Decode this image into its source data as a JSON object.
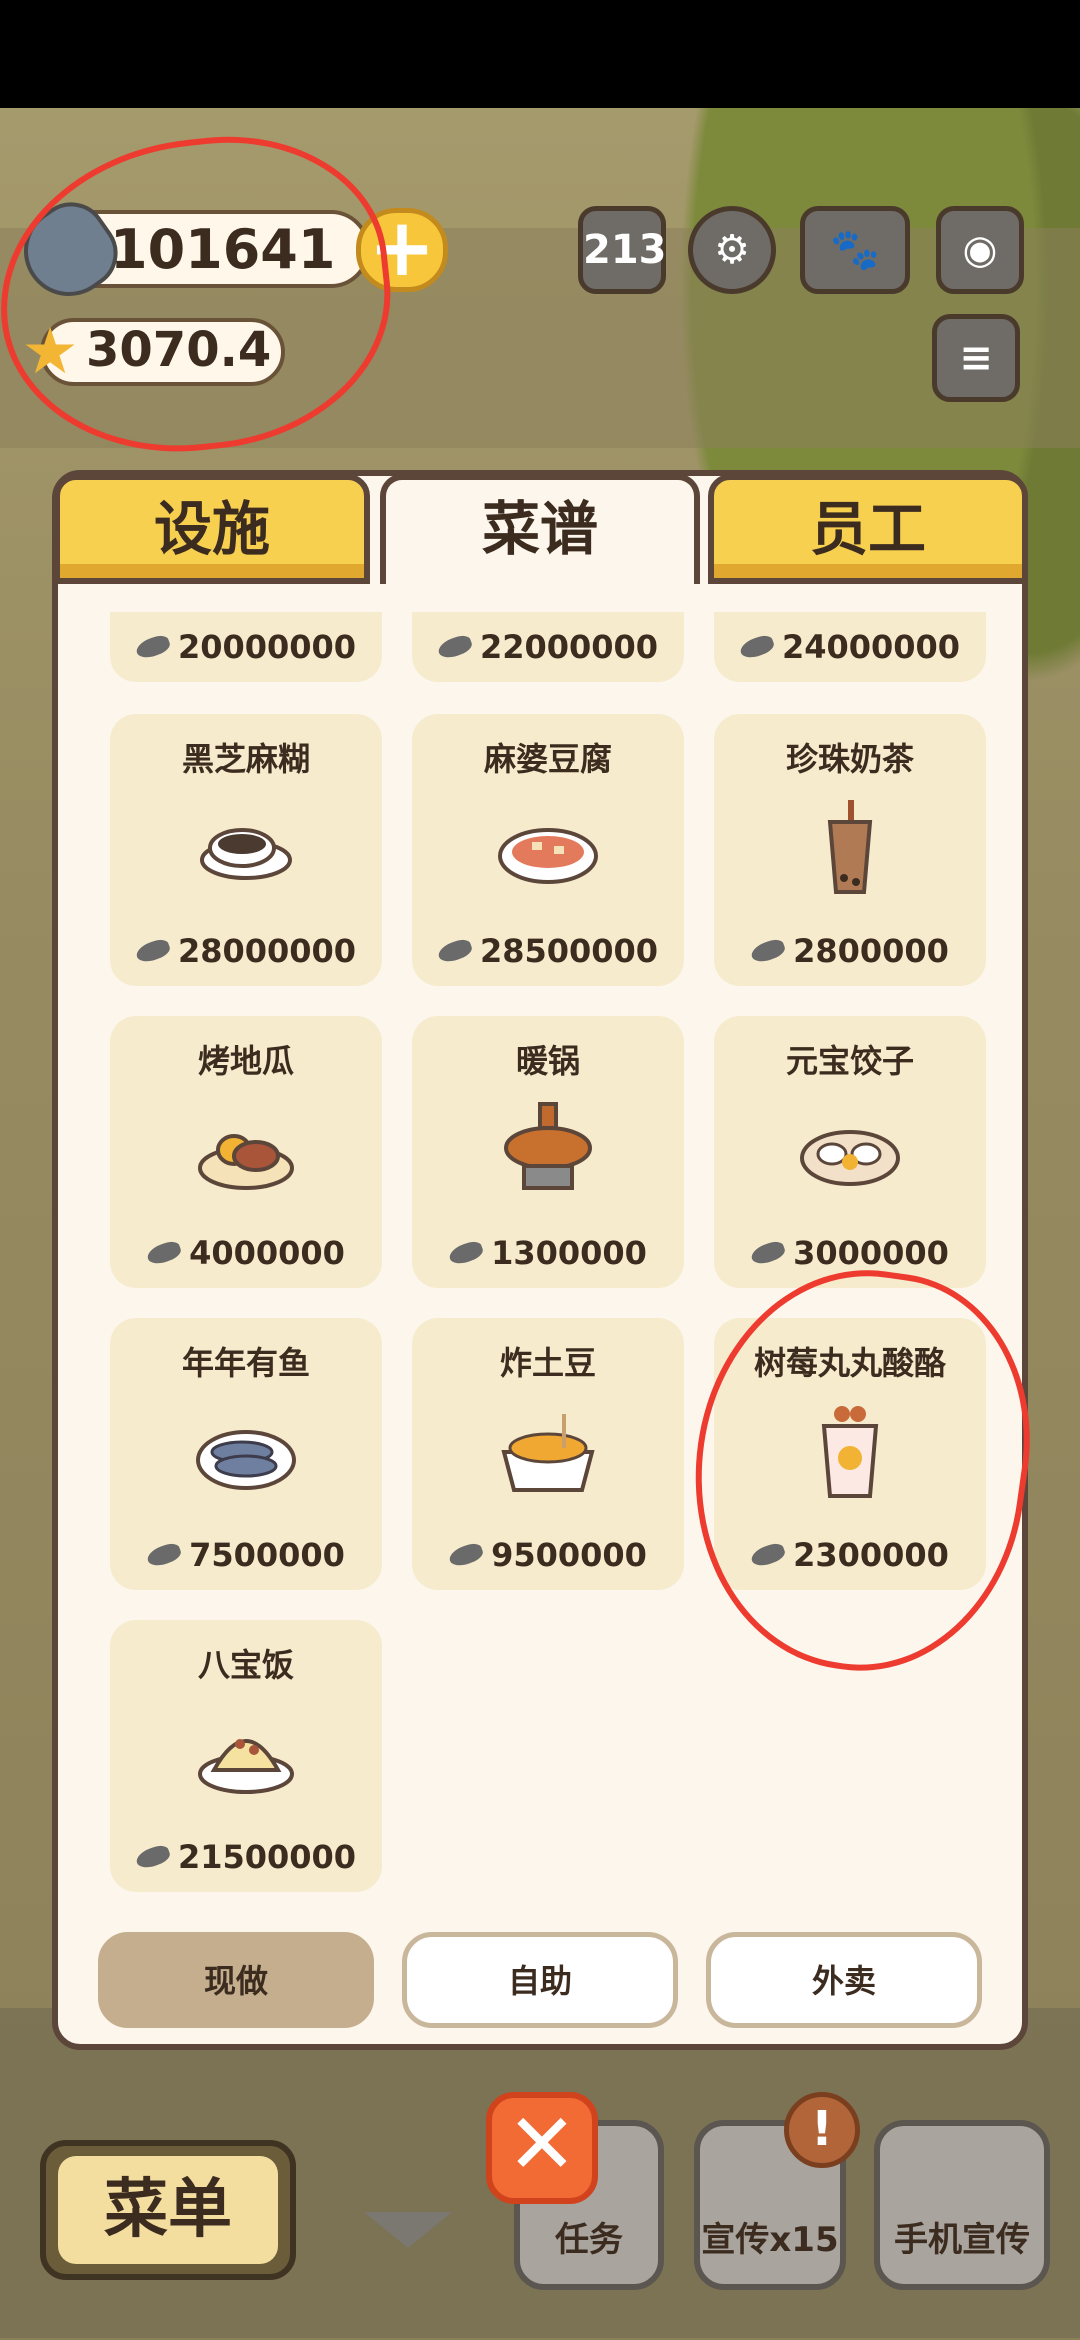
{
  "currency": {
    "fish_value": "101641",
    "star_value": "3070.4",
    "plus_symbol": "+"
  },
  "top_icons": [
    {
      "name": "ranking-icon",
      "glyph": "213"
    },
    {
      "name": "gear-icon",
      "glyph": "⚙"
    },
    {
      "name": "book-icon",
      "glyph": "🐾"
    },
    {
      "name": "camera-icon",
      "glyph": "◉"
    },
    {
      "name": "notice-icon",
      "glyph": "≡"
    }
  ],
  "tabs": [
    {
      "label": "设施",
      "active": false
    },
    {
      "label": "菜谱",
      "active": true
    },
    {
      "label": "员工",
      "active": false
    }
  ],
  "recipes_partial_top": [
    "20000000",
    "22000000",
    "24000000"
  ],
  "recipes": [
    {
      "name": "黑芝麻糊",
      "price": "28000000"
    },
    {
      "name": "麻婆豆腐",
      "price": "28500000"
    },
    {
      "name": "珍珠奶茶",
      "price": "2800000"
    },
    {
      "name": "烤地瓜",
      "price": "4000000"
    },
    {
      "name": "暖锅",
      "price": "1300000"
    },
    {
      "name": "元宝饺子",
      "price": "3000000"
    },
    {
      "name": "年年有鱼",
      "price": "7500000"
    },
    {
      "name": "炸土豆",
      "price": "9500000"
    },
    {
      "name": "树莓丸丸酸酪",
      "price": "2300000"
    },
    {
      "name": "八宝饭",
      "price": "21500000"
    }
  ],
  "modes": [
    {
      "label": "现做",
      "selected": true
    },
    {
      "label": "自助",
      "selected": false
    },
    {
      "label": "外卖",
      "selected": false
    }
  ],
  "bottom": {
    "menu_label": "菜单",
    "close_symbol": "✕",
    "task_label": "任务",
    "promo_label": "宣传x15",
    "phone_promo_label": "手机宣传",
    "alert_symbol": "!"
  },
  "colors": {
    "tab_inactive": "#f8d050",
    "panel_bg": "#fcf6ec",
    "card_bg": "#f6ebcc",
    "close_orange": "#f26a34",
    "annotation_red": "#ee3b2f"
  }
}
